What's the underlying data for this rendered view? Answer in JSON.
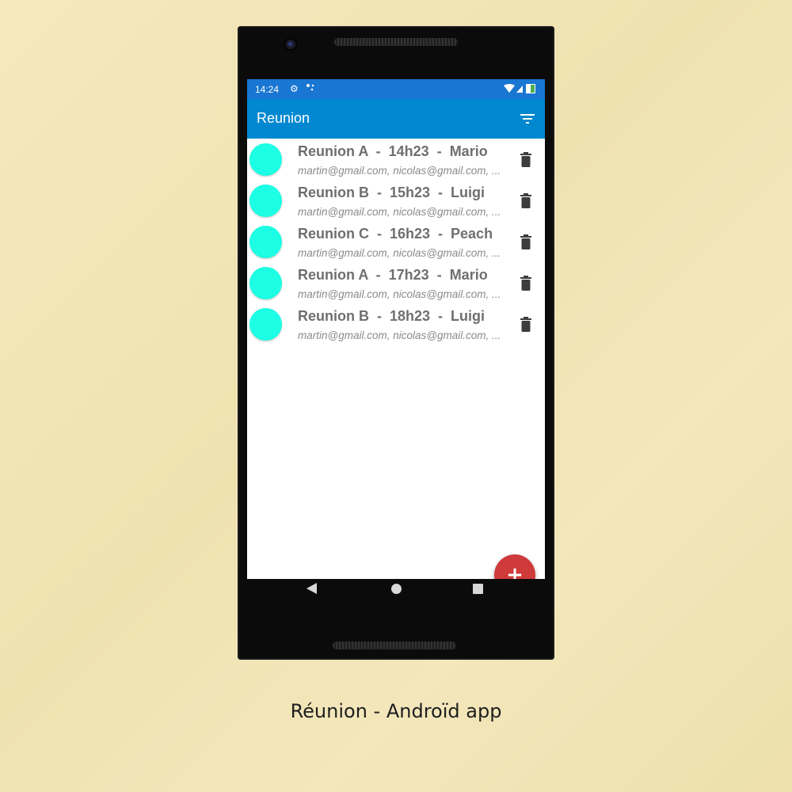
{
  "status_bar": {
    "time": "14:24",
    "icons": [
      "settings-icon",
      "dots-icon",
      "wifi-icon",
      "signal-icon",
      "battery-icon"
    ]
  },
  "app_bar": {
    "title": "Reunion",
    "filter_icon": "filter-icon"
  },
  "meetings": [
    {
      "title": "Reunion A  -  14h23  -  Mario",
      "participants": "martin@gmail.com, nicolas@gmail.com, ...",
      "avatar_color": "#1cffe4"
    },
    {
      "title": "Reunion B  -  15h23  -  Luigi",
      "participants": "martin@gmail.com, nicolas@gmail.com, ...",
      "avatar_color": "#1cffe4"
    },
    {
      "title": "Reunion C  -  16h23  -  Peach",
      "participants": "martin@gmail.com, nicolas@gmail.com, ...",
      "avatar_color": "#1cffe4"
    },
    {
      "title": "Reunion A  -  17h23  -  Mario",
      "participants": "martin@gmail.com, nicolas@gmail.com, ...",
      "avatar_color": "#1cffe4"
    },
    {
      "title": "Reunion B  -  18h23  -  Luigi",
      "participants": "martin@gmail.com, nicolas@gmail.com, ...",
      "avatar_color": "#1cffe4"
    }
  ],
  "fab": {
    "label": "+",
    "color": "#cf3a3a"
  },
  "nav_bar": {
    "icons": [
      "back-icon",
      "home-icon",
      "recent-apps-icon"
    ]
  },
  "colors": {
    "status_bar": "#1976d2",
    "app_bar": "#0288d1",
    "background": "#f2e6b8"
  },
  "caption": "Réunion - Androïd app"
}
